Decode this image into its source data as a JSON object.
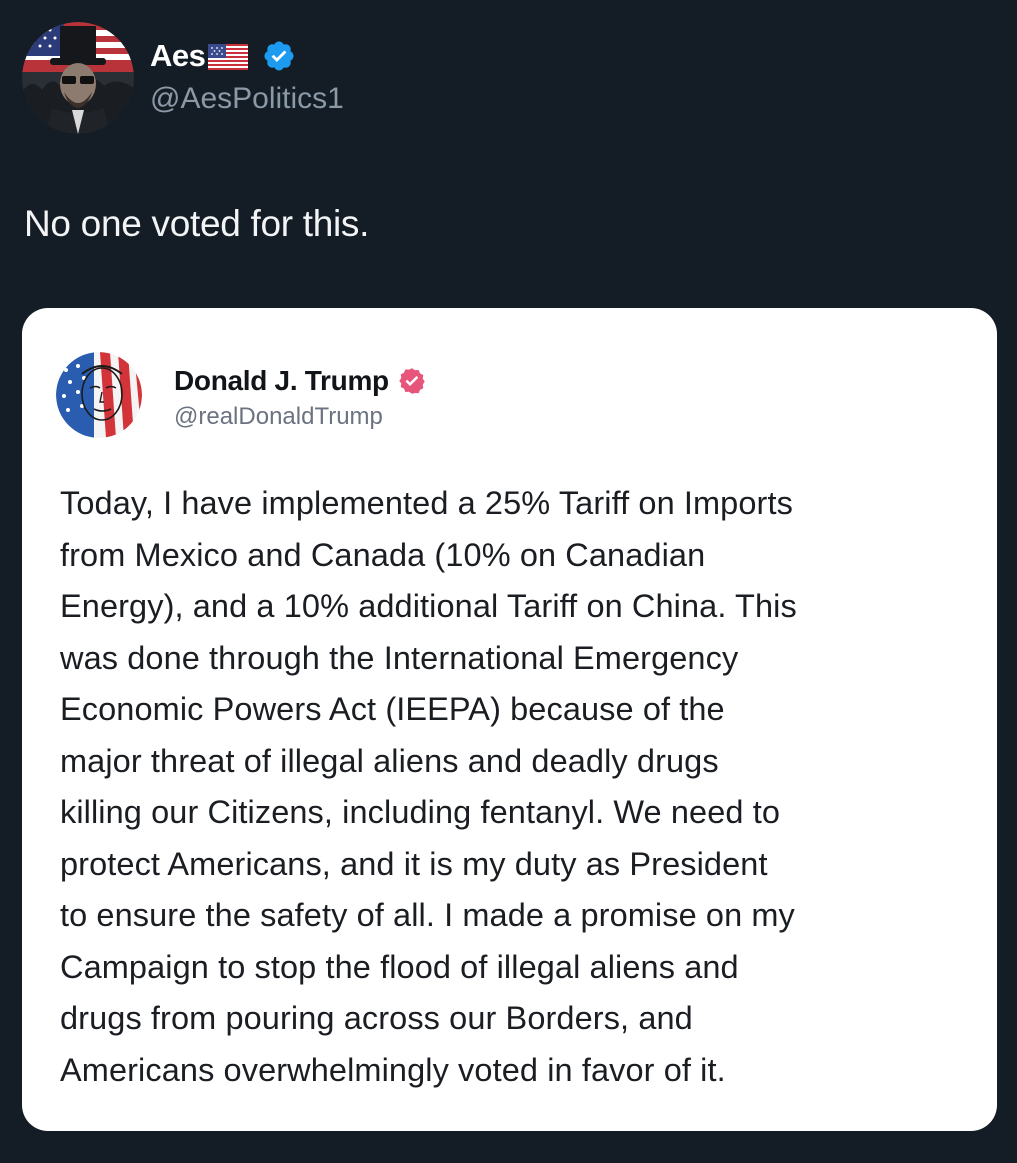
{
  "outer_post": {
    "author_name": "Aes",
    "author_name_emoji": "flag-us-icon",
    "handle": "@AesPolitics1",
    "verified_badge_color": "#1d9bf0",
    "text": "No one voted for this."
  },
  "quoted_post": {
    "author_name": "Donald J. Trump",
    "handle": "@realDonaldTrump",
    "verified_badge_color": "#e8557a",
    "lines": [
      "Today, I have implemented a 25% Tariff on Imports",
      "from Mexico and Canada (10% on Canadian",
      "Energy), and a 10% additional Tariff on China. This",
      "was done through the International Emergency",
      "Economic Powers Act (IEEPA) because of the",
      "major threat of illegal aliens and deadly drugs",
      "killing our Citizens, including fentanyl. We need to",
      "protect Americans, and it is my duty as President",
      "to ensure the safety of all. I made a promise on my",
      "Campaign to stop the flood of illegal aliens and",
      "drugs from pouring across our Borders, and",
      "Americans overwhelmingly voted in favor of it."
    ]
  },
  "colors": {
    "background": "#141d26",
    "card_background": "#ffffff"
  }
}
